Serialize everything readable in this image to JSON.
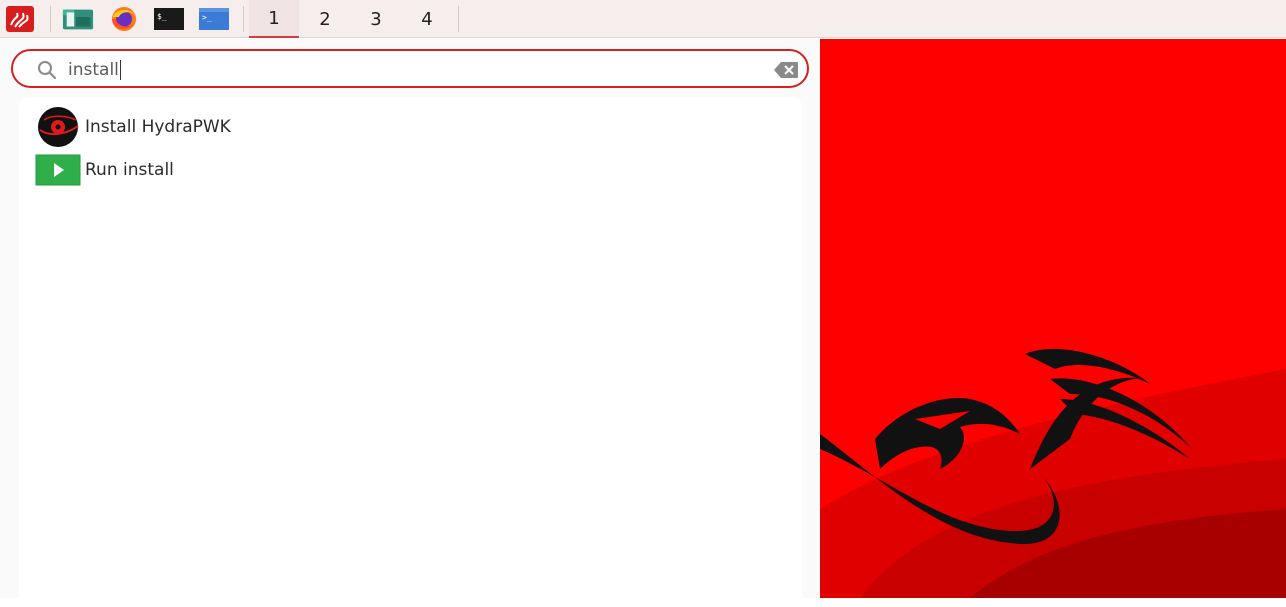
{
  "taskbar": {
    "launchers": [
      {
        "icon": "kali-menu-icon"
      },
      {
        "icon": "file-manager-icon"
      },
      {
        "icon": "firefox-icon"
      },
      {
        "icon": "terminal-icon",
        "glyph": "$_"
      },
      {
        "icon": "terminal-emulator-icon",
        "glyph": ">_"
      }
    ],
    "workspaces": [
      "1",
      "2",
      "3",
      "4"
    ],
    "active_workspace": "1"
  },
  "search": {
    "value": "install",
    "accent_color": "#d62020"
  },
  "results": [
    {
      "label": "Install HydraPWK",
      "icon": "hydrapwk-installer-icon"
    },
    {
      "label": "Run install",
      "icon": "run-play-icon"
    }
  ],
  "colors": {
    "wallpaper_red": "#ff0000",
    "wallpaper_dark_red": "#c00000",
    "accent": "#d62020"
  }
}
